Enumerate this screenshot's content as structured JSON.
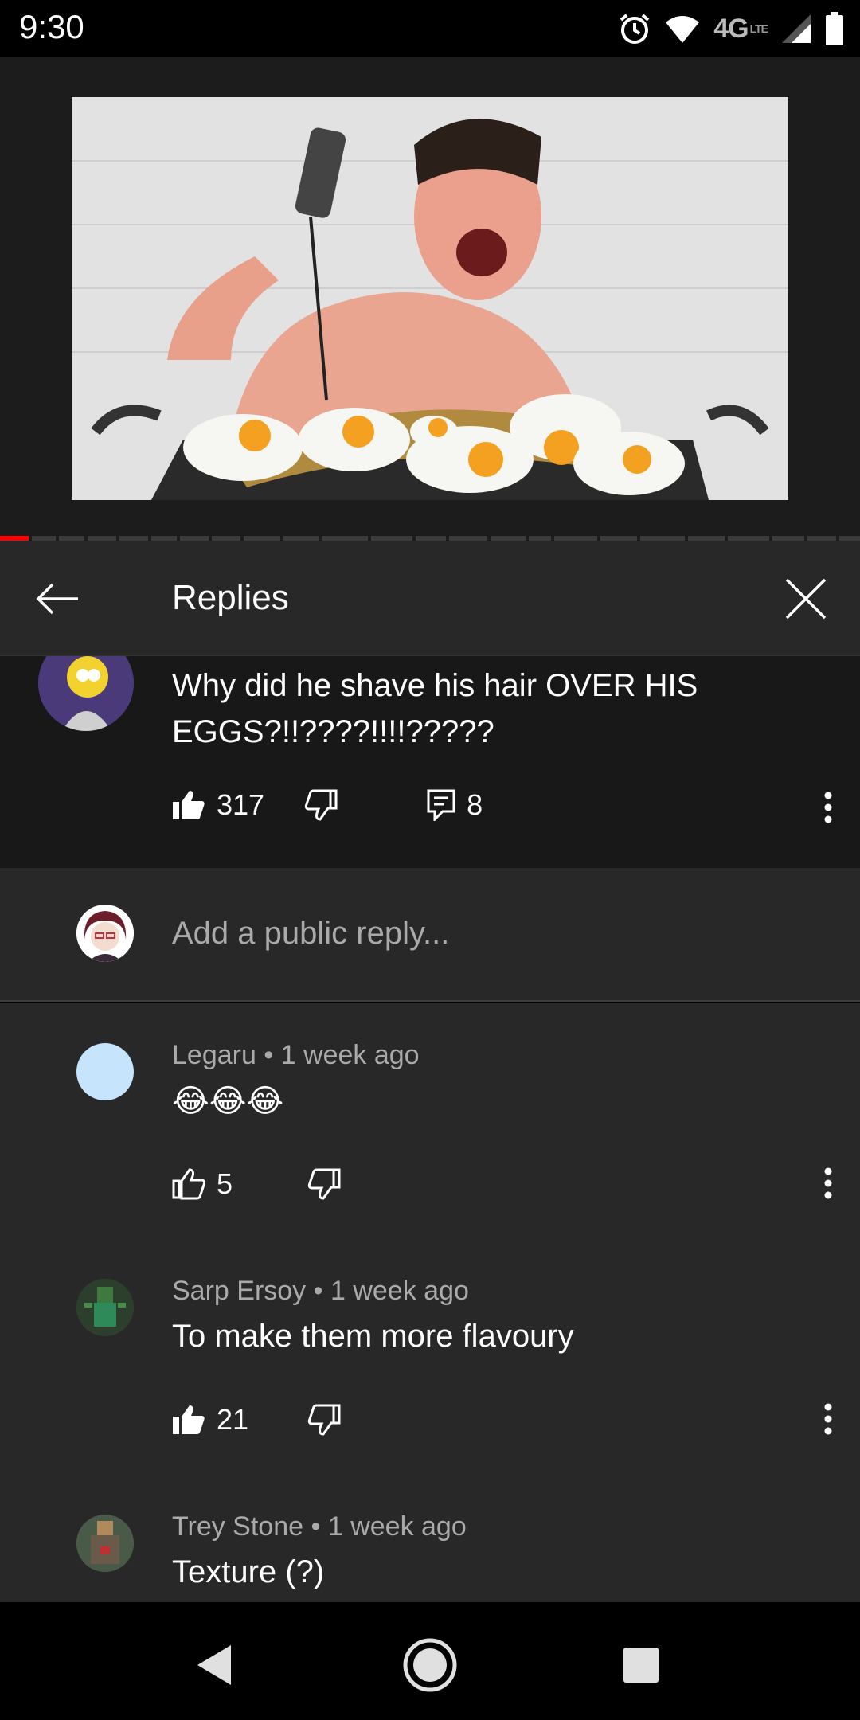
{
  "status_bar": {
    "time": "9:30",
    "network": "4G",
    "network_sub": "LTE",
    "icons": [
      "alarm-icon",
      "wifi-icon",
      "signal-icon",
      "battery-icon"
    ]
  },
  "video": {
    "progress_fraction": 0.033,
    "description_icon": "video-thumbnail"
  },
  "replies_header": {
    "title": "Replies"
  },
  "parent_comment": {
    "text": "Why did he shave his hair OVER HIS EGGS?!!????!!!!?????",
    "likes": "317",
    "replies": "8"
  },
  "add_reply": {
    "placeholder": "Add a public reply..."
  },
  "replies": [
    {
      "author": "Legaru",
      "age": "1 week ago",
      "text": "😂😂😂",
      "likes": "5",
      "avatar_color": "#c6e4fb"
    },
    {
      "author": "Sarp Ersoy",
      "age": "1 week ago",
      "text": "To make them more flavoury",
      "likes": "21",
      "avatar_color": "#2d4a2d"
    },
    {
      "author": "Trey Stone",
      "age": "1 week ago",
      "text": "Texture (?)",
      "likes": "",
      "avatar_color": "#5a5a4a"
    }
  ],
  "colors": {
    "accent_red": "#ff0000",
    "panel": "#282828",
    "parent_bg": "#181818",
    "muted_text": "#aaaaaa"
  }
}
